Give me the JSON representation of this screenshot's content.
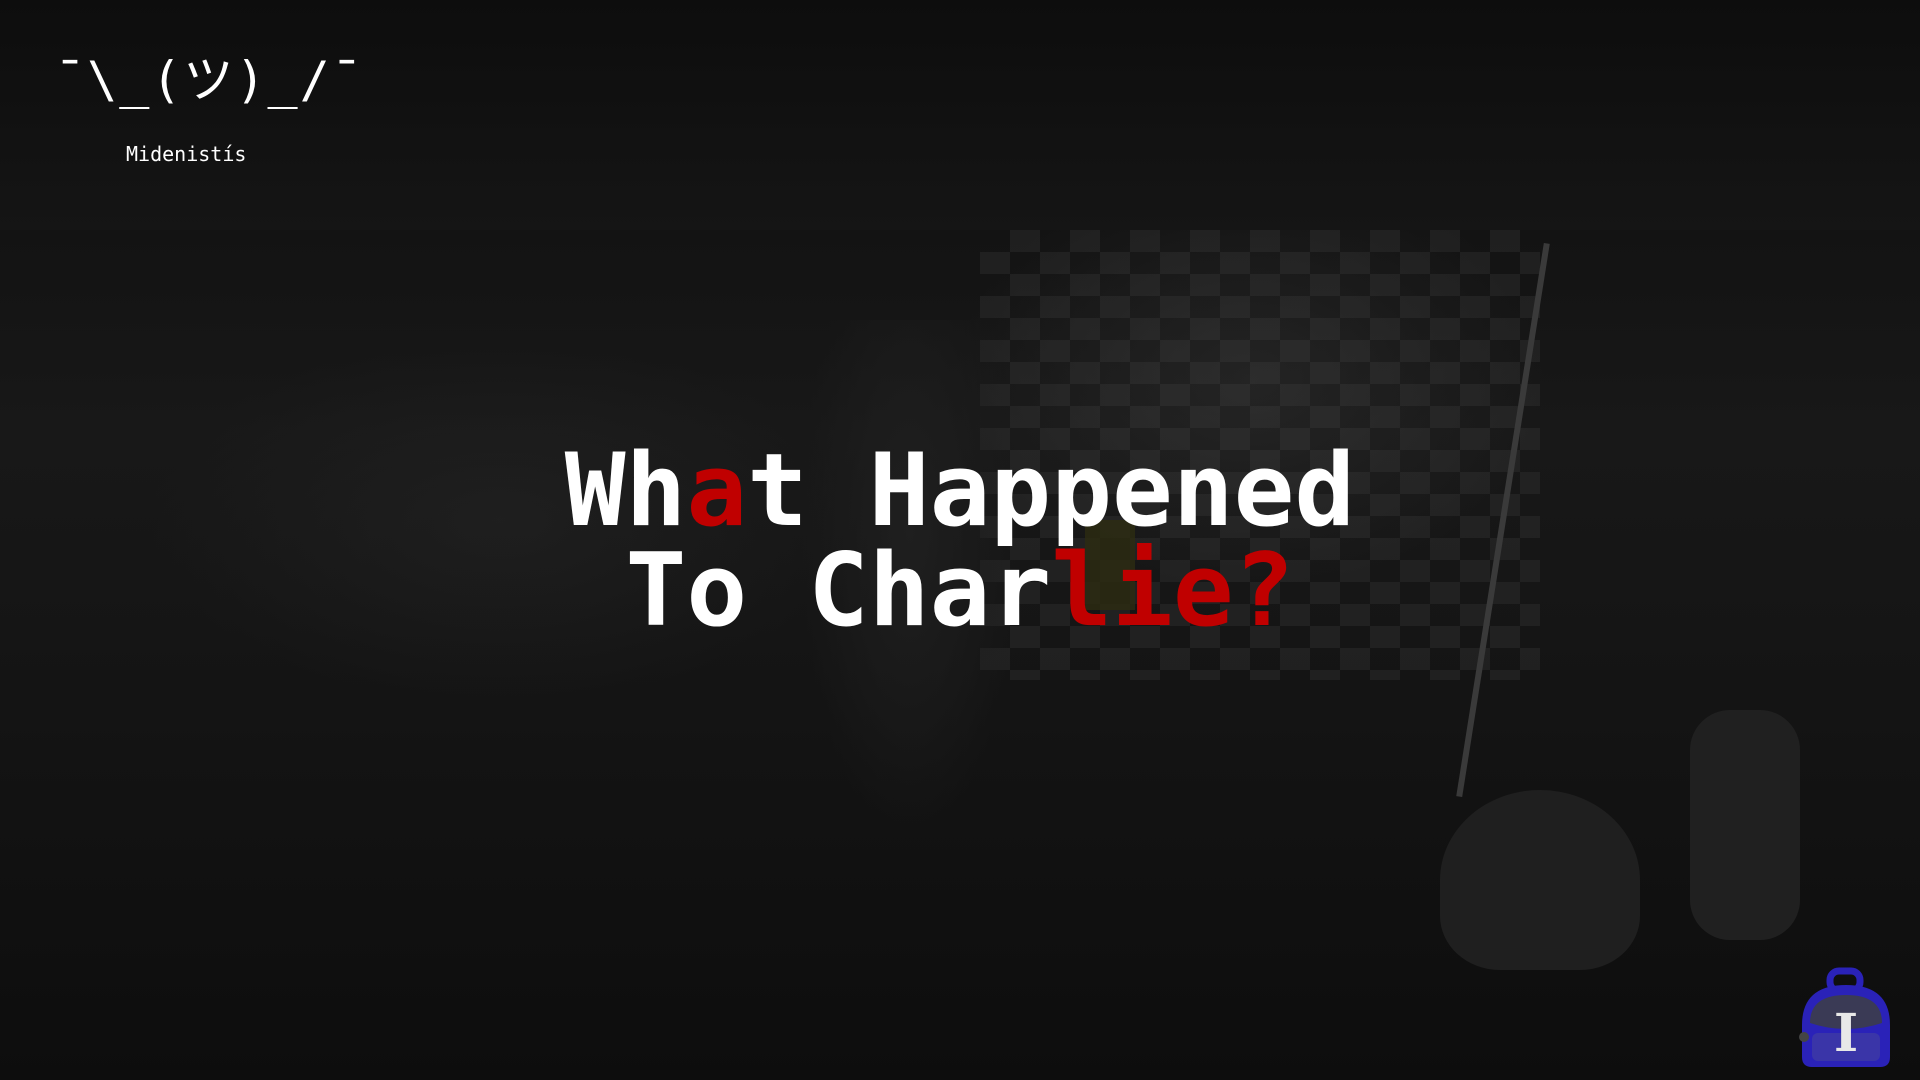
{
  "header": {
    "logo_text": "¯\\_(ツ)_/¯",
    "author": "Midenistís"
  },
  "title": {
    "line1": [
      {
        "t": "Wh",
        "red": false
      },
      {
        "t": "a",
        "red": true
      },
      {
        "t": "t Happened",
        "red": false
      }
    ],
    "line2": [
      {
        "t": "To Char",
        "red": false
      },
      {
        "t": "lie?",
        "red": true
      }
    ]
  },
  "inventory": {
    "icon": "backpack-icon",
    "letter": "I"
  },
  "colors": {
    "accent": "#c00000",
    "text": "#ffffff",
    "backpack": "#2a22b8"
  }
}
